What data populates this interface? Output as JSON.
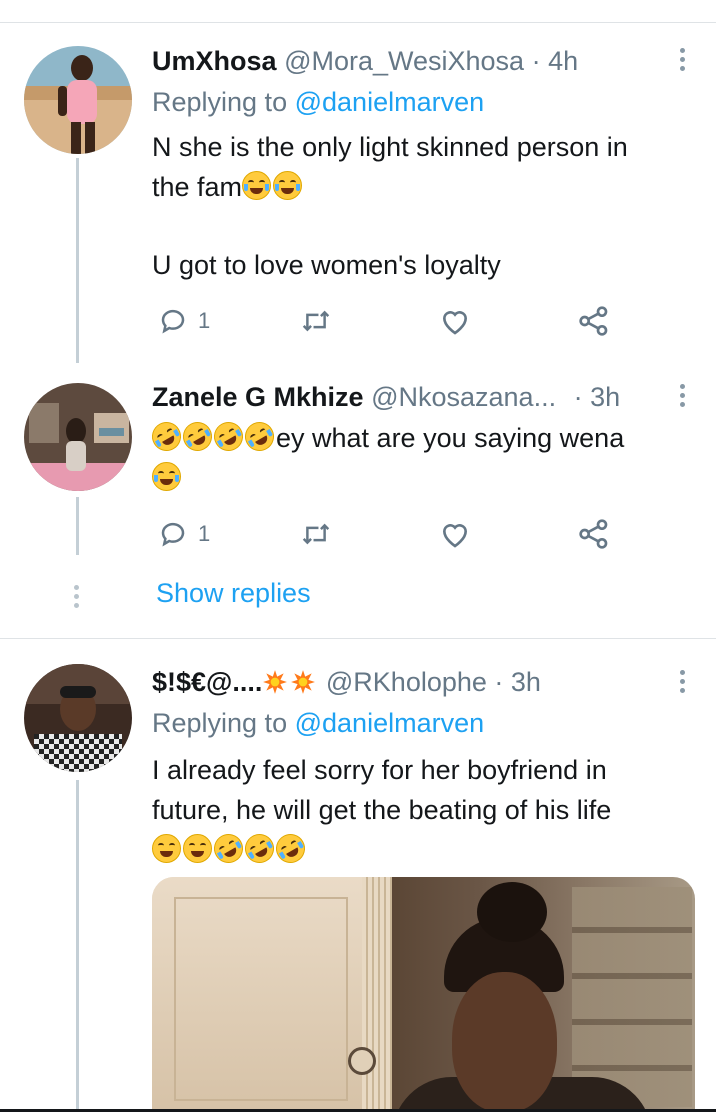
{
  "tweets": [
    {
      "name": "UmXhosa",
      "handle": "@Mora_WesiXhosa",
      "time": "· 4h",
      "replying_label": "Replying to",
      "replying_handle": "@danielmarven",
      "line1": "N she is the only light skinned person in",
      "line2": "the fam",
      "line3": "U got to love women's loyalty",
      "reply_count": "1"
    },
    {
      "name": "Zanele G Mkhize",
      "handle": "@Nkosazana...",
      "time": "· 3h",
      "text": "ey what are you saying wena",
      "reply_count": "1",
      "show_replies": "Show replies"
    },
    {
      "name": "$!$€@....",
      "handle": "@RKholophe",
      "time": "· 3h",
      "replying_label": "Replying to",
      "replying_handle": "@danielmarven",
      "line1": "I already feel sorry for her boyfriend in",
      "line2": "future, he will get the beating of his life"
    }
  ],
  "icons": {
    "reply": "reply-icon",
    "retweet": "retweet-icon",
    "like": "heart-icon",
    "share": "share-icon",
    "more": "more-vertical-icon"
  },
  "colors": {
    "link": "#1da1f2",
    "meta": "#657786",
    "thread": "#c4cfd6",
    "icon": "#657786"
  }
}
